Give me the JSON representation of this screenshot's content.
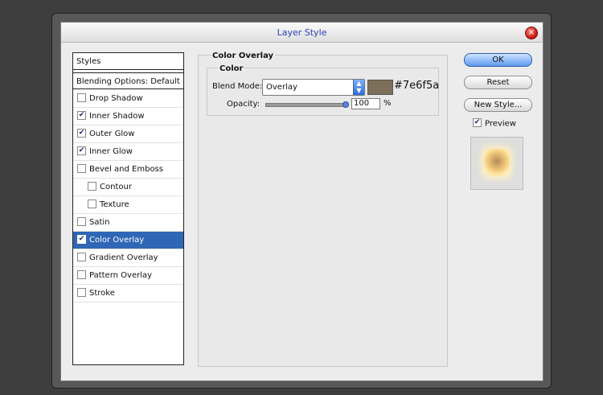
{
  "dialog": {
    "title": "Layer Style",
    "close_symbol": "×"
  },
  "styles_panel": {
    "header": "Styles",
    "blending_options": "Blending Options: Default",
    "items": [
      {
        "label": "Drop Shadow",
        "checked": false,
        "mark": ""
      },
      {
        "label": "Inner Shadow",
        "checked": true,
        "mark": "✔"
      },
      {
        "label": "Outer Glow",
        "checked": true,
        "mark": "✔"
      },
      {
        "label": "Inner Glow",
        "checked": true,
        "mark": "✔"
      },
      {
        "label": "Bevel and Emboss",
        "checked": false,
        "mark": ""
      },
      {
        "label": "Contour",
        "checked": false,
        "mark": ""
      },
      {
        "label": "Texture",
        "checked": false,
        "mark": ""
      },
      {
        "label": "Satin",
        "checked": false,
        "mark": ""
      },
      {
        "label": "Color Overlay",
        "checked": true,
        "mark": "✔",
        "selected": true
      },
      {
        "label": "Gradient Overlay",
        "checked": false,
        "mark": ""
      },
      {
        "label": "Pattern Overlay",
        "checked": false,
        "mark": ""
      },
      {
        "label": "Stroke",
        "checked": false,
        "mark": ""
      }
    ]
  },
  "color_overlay": {
    "title": "Color Overlay",
    "group_title": "Color",
    "blend_mode_label": "Blend Mode:",
    "blend_mode_value": "Overlay",
    "swatch_color": "#7e6f5a",
    "hex_text": "#7e6f5a",
    "opacity_label": "Opacity:",
    "opacity_value": "100",
    "opacity_unit": "%",
    "opacity_fraction": 1.0
  },
  "buttons": {
    "ok": "OK",
    "reset": "Reset",
    "new_style": "New Style...",
    "preview_label": "Preview",
    "preview_checked": true,
    "preview_mark": "✔"
  },
  "icons": {
    "close": "close-icon",
    "select_arrows": "updown-arrows-icon",
    "check": "checkmark-icon"
  },
  "colors": {
    "selected_row": "#2f66b5",
    "title_text": "#2a3fb6",
    "ok_button": "#5e9bf0"
  }
}
